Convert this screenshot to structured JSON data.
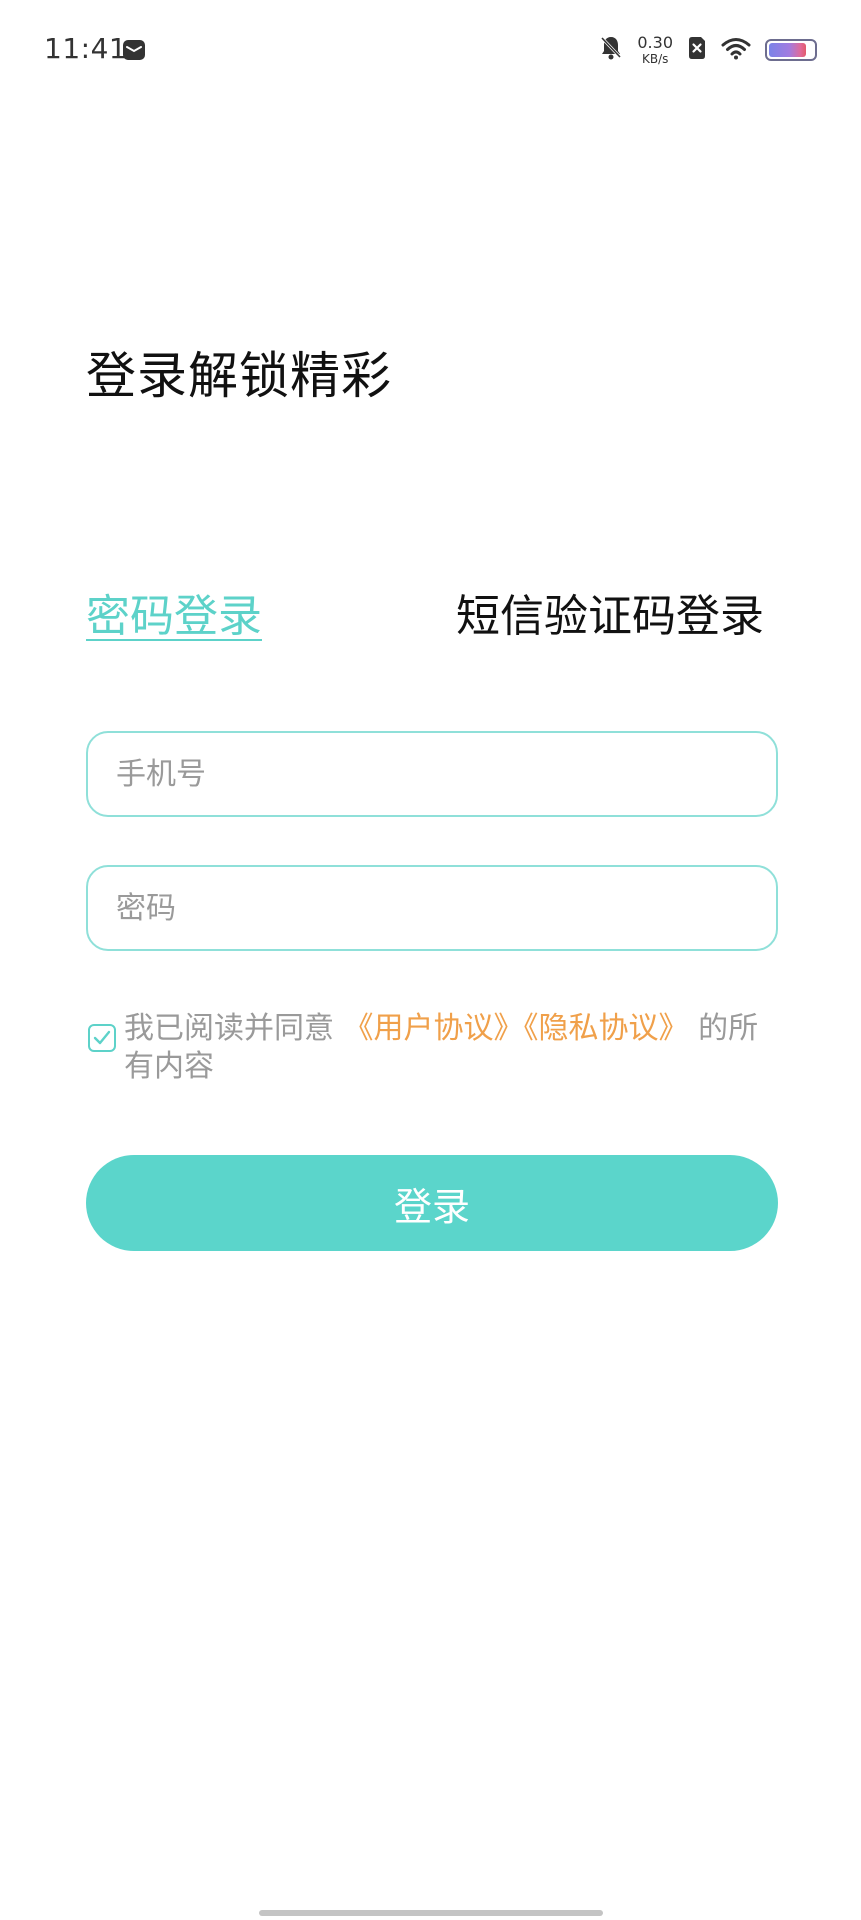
{
  "status_bar": {
    "time": "11:41",
    "net_speed_value": "0.30",
    "net_speed_unit": "KB/s",
    "battery_level": 0.85,
    "icons": [
      "mail-icon",
      "bell-muted-icon",
      "sim-off-icon",
      "wifi-icon",
      "battery-icon"
    ]
  },
  "headline": "登录解锁精彩",
  "tabs": {
    "password_login": "密码登录",
    "sms_login": "短信验证码登录"
  },
  "form": {
    "phone_placeholder": "手机号",
    "phone_value": "",
    "password_placeholder": "密码",
    "password_value": ""
  },
  "agreement": {
    "prefix": "我已阅读并同意",
    "user_agreement": "《用户协议》",
    "privacy_policy": "《隐私协议》",
    "suffix": "的所有内容",
    "checked": true
  },
  "login_button": "登录",
  "colors": {
    "accent": "#5bd5cb",
    "link": "#f0a04a",
    "placeholder": "#9a9a9a"
  }
}
